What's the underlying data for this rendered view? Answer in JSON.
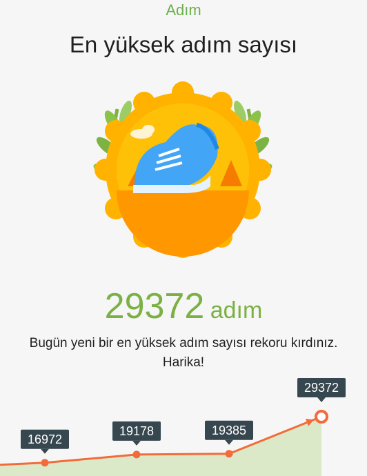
{
  "header": {
    "label": "Adım"
  },
  "title": "En yüksek adım sayısı",
  "record": {
    "value": "29372",
    "unit": "adım"
  },
  "message": "Bugün yeni bir en yüksek adım sayısı rekoru kırdınız. Harika!",
  "badge": {
    "icon": "running-shoe-trophy-icon"
  },
  "colors": {
    "accent_green": "#7bb043",
    "line_orange": "#f26b3a",
    "label_dark": "#37474f",
    "fill_green": "#dbe9c8"
  },
  "chart_data": {
    "type": "line",
    "title": "",
    "xlabel": "",
    "ylabel": "",
    "values": [
      16972,
      19178,
      19385,
      29372
    ],
    "labels": [
      "16972",
      "19178",
      "19385",
      "29372"
    ],
    "highlight_index": 3
  }
}
